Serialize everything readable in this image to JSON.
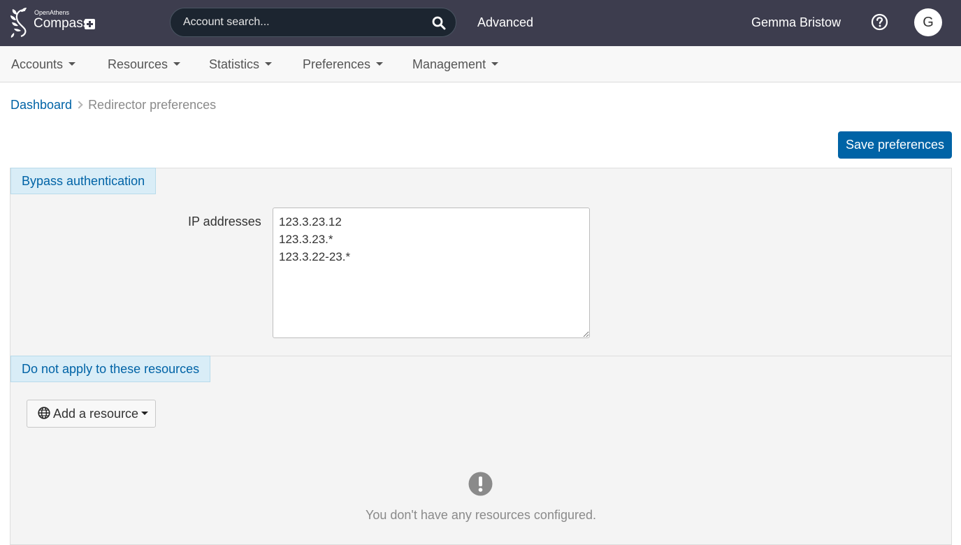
{
  "header": {
    "brand_small": "OpenAthens",
    "brand_main": "Compass",
    "search_placeholder": "Account search...",
    "advanced_label": "Advanced",
    "user_name": "Gemma Bristow",
    "avatar_initial": "G"
  },
  "nav": {
    "items": [
      {
        "label": "Accounts"
      },
      {
        "label": "Resources"
      },
      {
        "label": "Statistics"
      },
      {
        "label": "Preferences"
      },
      {
        "label": "Management"
      }
    ]
  },
  "breadcrumb": {
    "home": "Dashboard",
    "current": "Redirector preferences"
  },
  "actions": {
    "save_label": "Save preferences"
  },
  "bypass": {
    "tab_label": "Bypass authentication",
    "ip_label": "IP addresses",
    "ip_value": "123.3.23.12\n123.3.23.*\n123.3.22-23.*"
  },
  "exclusions": {
    "tab_label": "Do not apply to these resources",
    "add_label": "Add a resource",
    "empty_message": "You don't have any resources configured."
  },
  "icons": {
    "logo": "openathens-leaf-icon",
    "search": "search-icon",
    "help": "help-icon",
    "globe": "globe-icon",
    "empty": "exclamation-circle-icon"
  },
  "colors": {
    "topbar": "#3d3d4e",
    "primary": "#0063a6",
    "tab_bg": "#d9edf7",
    "panel_bg": "#f4f4f4"
  }
}
